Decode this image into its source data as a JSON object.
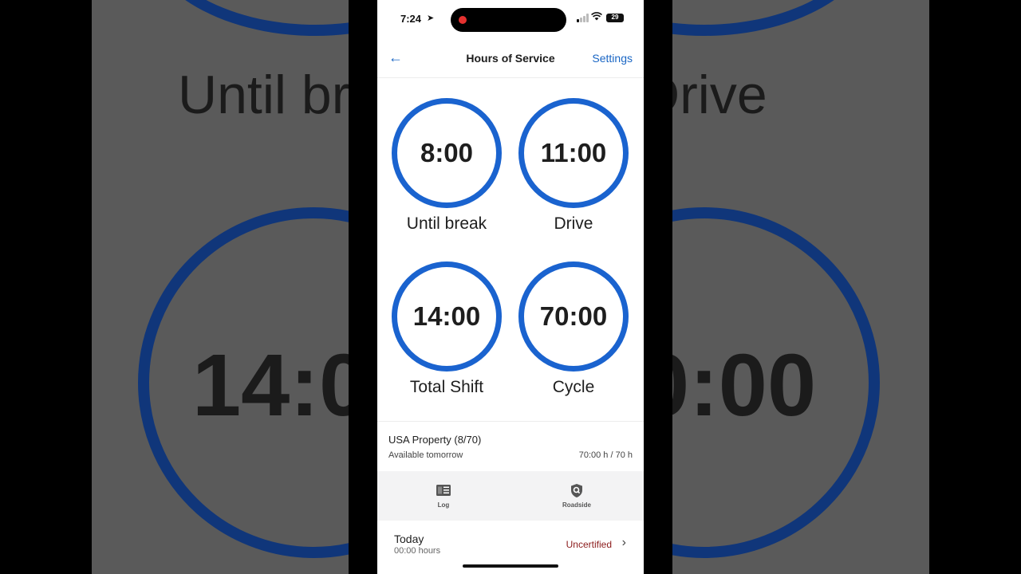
{
  "status_bar": {
    "time": "7:24",
    "battery": "29"
  },
  "header": {
    "title": "Hours of Service",
    "settings_label": "Settings"
  },
  "gauges": [
    {
      "value": "8:00",
      "label": "Until break"
    },
    {
      "value": "11:00",
      "label": "Drive"
    },
    {
      "value": "14:00",
      "label": "Total Shift"
    },
    {
      "value": "70:00",
      "label": "Cycle"
    }
  ],
  "cycle_info": {
    "rule_name": "USA Property (8/70)",
    "availability": "Available tomorrow",
    "hours": "70:00 h / 70 h"
  },
  "tabs": [
    {
      "label": "Log",
      "icon": "log-icon"
    },
    {
      "label": "Roadside",
      "icon": "roadside-shield-icon"
    }
  ],
  "today": {
    "label": "Today",
    "hours": "00:00 hours",
    "status": "Uncertified"
  },
  "colors": {
    "accent": "#1a63cf",
    "uncertified": "#8b1a1a"
  },
  "backdrop": {
    "left_text_top": "Until br",
    "left_text_mid": "14:0",
    "right_text_top": "Drive",
    "right_text_mid": "0:00"
  }
}
